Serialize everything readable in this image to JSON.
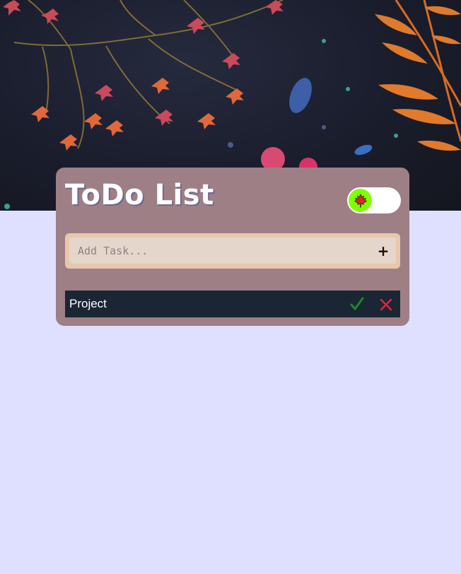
{
  "app": {
    "title": "ToDo List"
  },
  "theme_toggle": {
    "icon": "maple-leaf-icon",
    "knob_color": "#7fff00",
    "state": "off"
  },
  "input": {
    "placeholder": "Add Task...",
    "value": "",
    "add_icon": "plus-icon"
  },
  "tasks": [
    {
      "text": "Project",
      "complete_icon": "checkmark-icon",
      "delete_icon": "close-icon"
    }
  ],
  "colors": {
    "page_background": "#dfe0ff",
    "card_background": "#9e7f85",
    "input_frame": "#e8c7ad",
    "input_fill": "#e5d6cb",
    "task_background": "#1a2633",
    "check_color": "#1a8a2a",
    "delete_color": "#e0243a"
  }
}
